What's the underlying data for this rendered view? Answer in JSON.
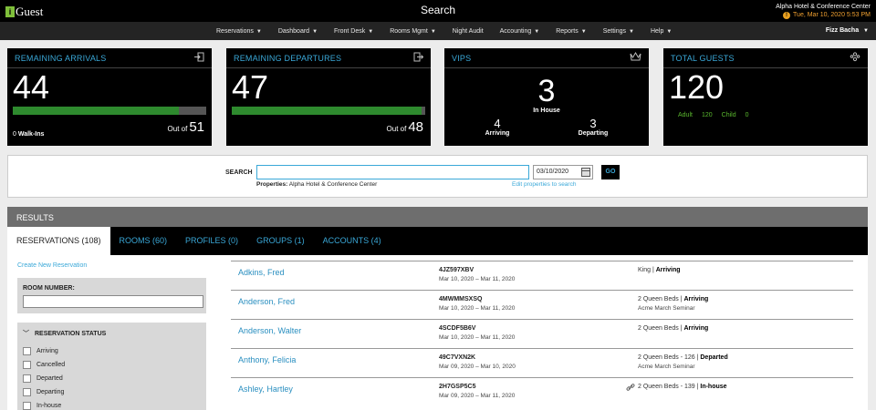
{
  "app": {
    "logo_mark": "i",
    "logo_text": "Guest",
    "title": "Search"
  },
  "header": {
    "property_name": "Alpha Hotel & Conference Center",
    "datetime": "Tue, Mar 10, 2020 5:53 PM",
    "alert_glyph": "!"
  },
  "nav": {
    "items": [
      {
        "label": "Reservations",
        "caret": true
      },
      {
        "label": "Dashboard",
        "caret": true
      },
      {
        "label": "Front Desk",
        "caret": true
      },
      {
        "label": "Rooms Mgmt",
        "caret": true
      },
      {
        "label": "Night Audit",
        "caret": false
      },
      {
        "label": "Accounting",
        "caret": true
      },
      {
        "label": "Reports",
        "caret": true
      },
      {
        "label": "Settings",
        "caret": true
      },
      {
        "label": "Help",
        "caret": true
      }
    ],
    "user": "Fizz Bacha"
  },
  "cards": {
    "arrivals": {
      "title": "REMAINING ARRIVALS",
      "value": "44",
      "out_of_label": "Out of",
      "out_of": "51",
      "progress": 0.86,
      "walkins_count": "0",
      "walkins_label": "Walk-Ins",
      "icon": "sign-in-icon"
    },
    "departures": {
      "title": "REMAINING DEPARTURES",
      "value": "47",
      "out_of_label": "Out of",
      "out_of": "48",
      "progress": 0.98,
      "icon": "sign-out-icon"
    },
    "vips": {
      "title": "VIPS",
      "in_house": "3",
      "in_house_label": "In House",
      "arriving": "4",
      "arriving_label": "Arriving",
      "departing": "3",
      "departing_label": "Departing",
      "icon": "crown-icon"
    },
    "guests": {
      "title": "TOTAL GUESTS",
      "value": "120",
      "adult_label": "Adult",
      "adult": "120",
      "child_label": "Child",
      "child": "0",
      "icon": "people-icon"
    }
  },
  "search": {
    "label": "SEARCH",
    "value": "",
    "date": "03/10/2020",
    "go": "GO",
    "properties_label": "Properties:",
    "properties_value": "Alpha Hotel & Conference Center",
    "edit_link": "Edit properties to search"
  },
  "results": {
    "title": "RESULTS",
    "tabs": [
      "RESERVATIONS (108)",
      "ROOMS (60)",
      "PROFILES (0)",
      "GROUPS (1)",
      "ACCOUNTS (4)"
    ],
    "active_tab": 0
  },
  "filters": {
    "create_link": "Create New Reservation",
    "room_number_label": "ROOM NUMBER:",
    "status_label": "RESERVATION STATUS",
    "statuses": [
      "Arriving",
      "Cancelled",
      "Departed",
      "Departing",
      "In-house"
    ]
  },
  "reservations": [
    {
      "name": "Adkins, Fred",
      "conf": "4JZ597XBV",
      "dates": "Mar 10, 2020 – Mar 11, 2020",
      "room": "King | ",
      "status": "Arriving",
      "group": "",
      "linked": false
    },
    {
      "name": "Anderson, Fred",
      "conf": "4MWMMSXSQ",
      "dates": "Mar 10, 2020 – Mar 11, 2020",
      "room": "2 Queen Beds | ",
      "status": "Arriving",
      "group": "Acme March Seminar",
      "linked": false
    },
    {
      "name": "Anderson, Walter",
      "conf": "4SCDF5B6V",
      "dates": "Mar 10, 2020 – Mar 11, 2020",
      "room": "2 Queen Beds | ",
      "status": "Arriving",
      "group": "",
      "linked": false
    },
    {
      "name": "Anthony, Felicia",
      "conf": "49C7VXN2K",
      "dates": "Mar 09, 2020 – Mar 10, 2020",
      "room": "2 Queen Beds - 126 | ",
      "status": "Departed",
      "group": "Acme March Seminar",
      "linked": false
    },
    {
      "name": "Ashley, Hartley",
      "conf": "2H7GSP5C5",
      "dates": "Mar 09, 2020 – Mar 11, 2020",
      "room": "2 Queen Beds - 139 | ",
      "status": "In-house",
      "group": "",
      "linked": true
    }
  ]
}
